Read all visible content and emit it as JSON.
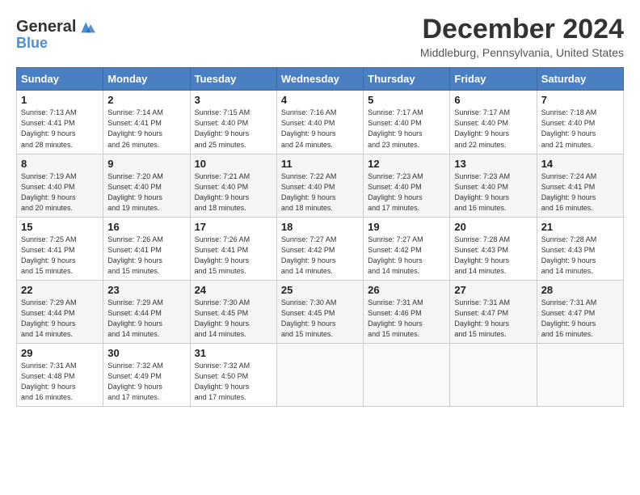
{
  "logo": {
    "line1": "General",
    "line2": "Blue"
  },
  "title": "December 2024",
  "location": "Middleburg, Pennsylvania, United States",
  "days_of_week": [
    "Sunday",
    "Monday",
    "Tuesday",
    "Wednesday",
    "Thursday",
    "Friday",
    "Saturday"
  ],
  "weeks": [
    [
      {
        "day": "1",
        "info": "Sunrise: 7:13 AM\nSunset: 4:41 PM\nDaylight: 9 hours\nand 28 minutes."
      },
      {
        "day": "2",
        "info": "Sunrise: 7:14 AM\nSunset: 4:41 PM\nDaylight: 9 hours\nand 26 minutes."
      },
      {
        "day": "3",
        "info": "Sunrise: 7:15 AM\nSunset: 4:40 PM\nDaylight: 9 hours\nand 25 minutes."
      },
      {
        "day": "4",
        "info": "Sunrise: 7:16 AM\nSunset: 4:40 PM\nDaylight: 9 hours\nand 24 minutes."
      },
      {
        "day": "5",
        "info": "Sunrise: 7:17 AM\nSunset: 4:40 PM\nDaylight: 9 hours\nand 23 minutes."
      },
      {
        "day": "6",
        "info": "Sunrise: 7:17 AM\nSunset: 4:40 PM\nDaylight: 9 hours\nand 22 minutes."
      },
      {
        "day": "7",
        "info": "Sunrise: 7:18 AM\nSunset: 4:40 PM\nDaylight: 9 hours\nand 21 minutes."
      }
    ],
    [
      {
        "day": "8",
        "info": "Sunrise: 7:19 AM\nSunset: 4:40 PM\nDaylight: 9 hours\nand 20 minutes."
      },
      {
        "day": "9",
        "info": "Sunrise: 7:20 AM\nSunset: 4:40 PM\nDaylight: 9 hours\nand 19 minutes."
      },
      {
        "day": "10",
        "info": "Sunrise: 7:21 AM\nSunset: 4:40 PM\nDaylight: 9 hours\nand 18 minutes."
      },
      {
        "day": "11",
        "info": "Sunrise: 7:22 AM\nSunset: 4:40 PM\nDaylight: 9 hours\nand 18 minutes."
      },
      {
        "day": "12",
        "info": "Sunrise: 7:23 AM\nSunset: 4:40 PM\nDaylight: 9 hours\nand 17 minutes."
      },
      {
        "day": "13",
        "info": "Sunrise: 7:23 AM\nSunset: 4:40 PM\nDaylight: 9 hours\nand 16 minutes."
      },
      {
        "day": "14",
        "info": "Sunrise: 7:24 AM\nSunset: 4:41 PM\nDaylight: 9 hours\nand 16 minutes."
      }
    ],
    [
      {
        "day": "15",
        "info": "Sunrise: 7:25 AM\nSunset: 4:41 PM\nDaylight: 9 hours\nand 15 minutes."
      },
      {
        "day": "16",
        "info": "Sunrise: 7:26 AM\nSunset: 4:41 PM\nDaylight: 9 hours\nand 15 minutes."
      },
      {
        "day": "17",
        "info": "Sunrise: 7:26 AM\nSunset: 4:41 PM\nDaylight: 9 hours\nand 15 minutes."
      },
      {
        "day": "18",
        "info": "Sunrise: 7:27 AM\nSunset: 4:42 PM\nDaylight: 9 hours\nand 14 minutes."
      },
      {
        "day": "19",
        "info": "Sunrise: 7:27 AM\nSunset: 4:42 PM\nDaylight: 9 hours\nand 14 minutes."
      },
      {
        "day": "20",
        "info": "Sunrise: 7:28 AM\nSunset: 4:43 PM\nDaylight: 9 hours\nand 14 minutes."
      },
      {
        "day": "21",
        "info": "Sunrise: 7:28 AM\nSunset: 4:43 PM\nDaylight: 9 hours\nand 14 minutes."
      }
    ],
    [
      {
        "day": "22",
        "info": "Sunrise: 7:29 AM\nSunset: 4:44 PM\nDaylight: 9 hours\nand 14 minutes."
      },
      {
        "day": "23",
        "info": "Sunrise: 7:29 AM\nSunset: 4:44 PM\nDaylight: 9 hours\nand 14 minutes."
      },
      {
        "day": "24",
        "info": "Sunrise: 7:30 AM\nSunset: 4:45 PM\nDaylight: 9 hours\nand 14 minutes."
      },
      {
        "day": "25",
        "info": "Sunrise: 7:30 AM\nSunset: 4:45 PM\nDaylight: 9 hours\nand 15 minutes."
      },
      {
        "day": "26",
        "info": "Sunrise: 7:31 AM\nSunset: 4:46 PM\nDaylight: 9 hours\nand 15 minutes."
      },
      {
        "day": "27",
        "info": "Sunrise: 7:31 AM\nSunset: 4:47 PM\nDaylight: 9 hours\nand 15 minutes."
      },
      {
        "day": "28",
        "info": "Sunrise: 7:31 AM\nSunset: 4:47 PM\nDaylight: 9 hours\nand 16 minutes."
      }
    ],
    [
      {
        "day": "29",
        "info": "Sunrise: 7:31 AM\nSunset: 4:48 PM\nDaylight: 9 hours\nand 16 minutes."
      },
      {
        "day": "30",
        "info": "Sunrise: 7:32 AM\nSunset: 4:49 PM\nDaylight: 9 hours\nand 17 minutes."
      },
      {
        "day": "31",
        "info": "Sunrise: 7:32 AM\nSunset: 4:50 PM\nDaylight: 9 hours\nand 17 minutes."
      },
      {
        "day": "",
        "info": ""
      },
      {
        "day": "",
        "info": ""
      },
      {
        "day": "",
        "info": ""
      },
      {
        "day": "",
        "info": ""
      }
    ]
  ]
}
